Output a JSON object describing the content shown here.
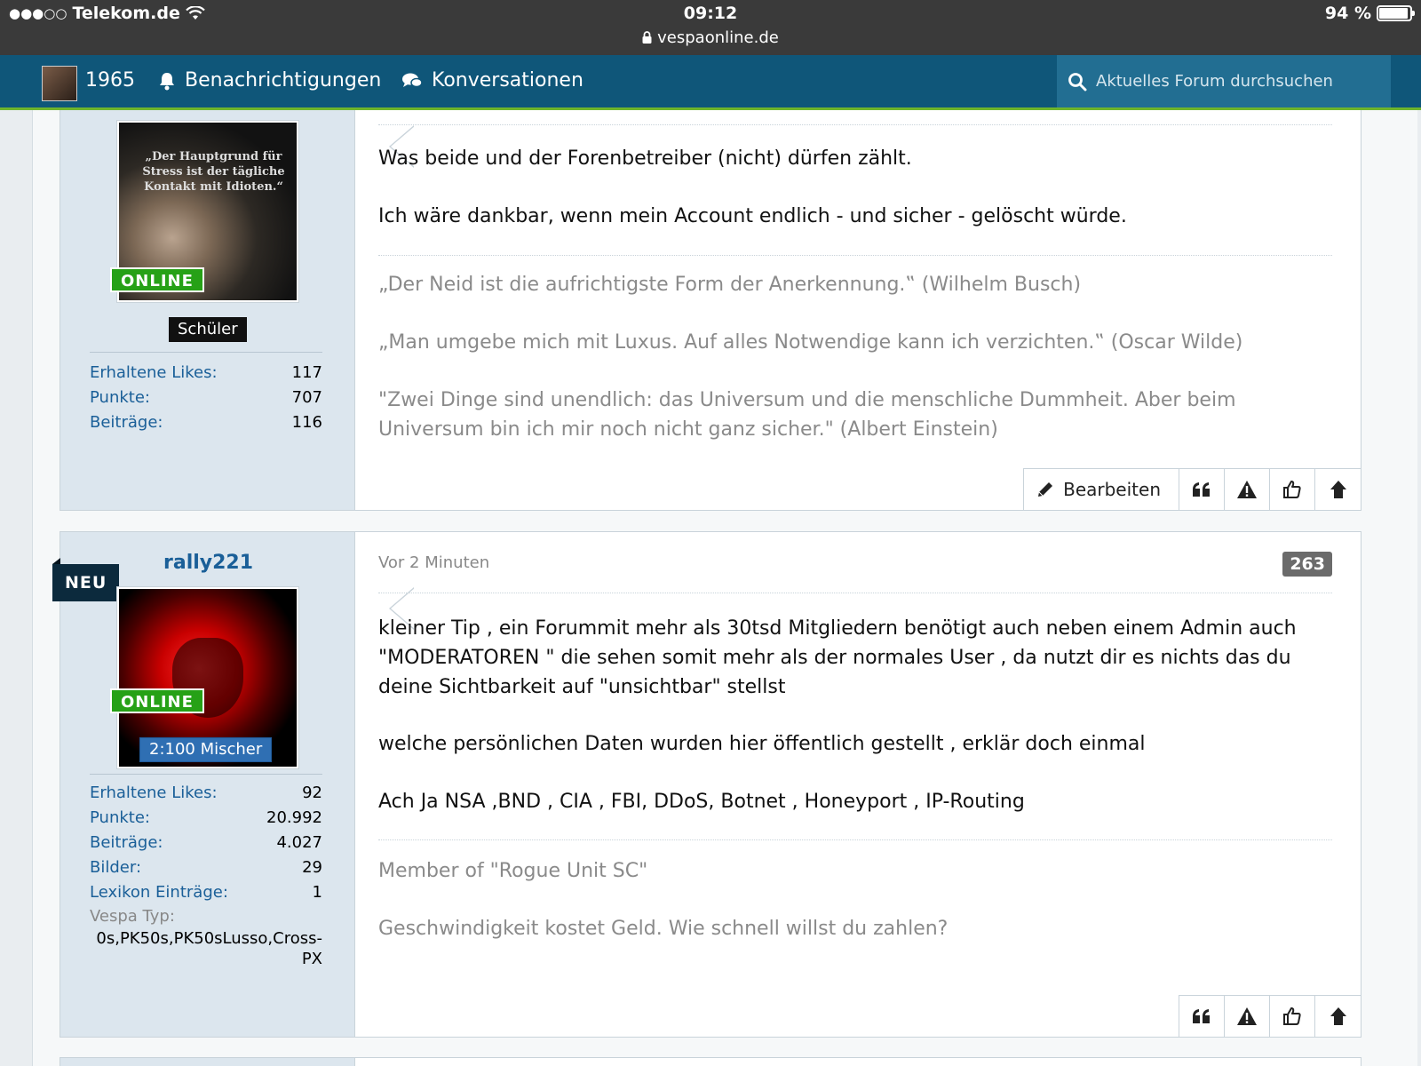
{
  "status_bar": {
    "signal": "●●●○○",
    "carrier": "Telekom.de",
    "time": "09:12",
    "url": "vespaonline.de",
    "battery": "94 %",
    "battery_level": 0.94
  },
  "nav": {
    "user_label": "1965",
    "notifications": "Benachrichtigungen",
    "conversations": "Konversationen",
    "search_placeholder": "Aktuelles Forum durchsuchen"
  },
  "icons": {
    "lock": "lock-icon",
    "wifi": "wifi-icon",
    "bell": "bell-icon",
    "chat": "chat-icon",
    "search": "search-icon",
    "edit": "pencil-icon",
    "quote": "quote-icon",
    "report": "warning-icon",
    "like": "thumbs-up-icon",
    "top": "arrow-up-icon"
  },
  "colors": {
    "nav": "#0f5679",
    "accent_green": "#6fb52c",
    "online": "#26a116",
    "link": "#1a5f98"
  },
  "post1": {
    "avatar_quote": "„Der Hauptgrund für Stress ist der tägliche Kontakt mit Idioten.“",
    "online": "ONLINE",
    "rank": "Schüler",
    "stats": [
      {
        "label": "Erhaltene Likes",
        "value": "117"
      },
      {
        "label": "Punkte",
        "value": "707"
      },
      {
        "label": "Beiträge",
        "value": "116"
      }
    ],
    "body": [
      "Was beide und der Forenbetreiber (nicht) dürfen zählt.",
      "Ich wäre dankbar, wenn mein Account endlich - und sicher - gelöscht würde."
    ],
    "signature": [
      "„Der Neid ist die aufrichtigste Form der Anerkennung.‟ (Wilhelm Busch)",
      "„Man umgebe mich mit Luxus. Auf alles Notwendige kann ich verzichten.‟ (Oscar Wilde)",
      "\"Zwei Dinge sind unendlich: das Universum und die menschliche Dummheit. Aber beim Universum bin ich mir noch nicht ganz sicher.\" (Albert Einstein)"
    ],
    "edit_label": "Bearbeiten"
  },
  "post2": {
    "badge": "NEU",
    "username": "rally221",
    "online": "ONLINE",
    "rank": "2:100 Mischer",
    "stats": [
      {
        "label": "Erhaltene Likes",
        "value": "92"
      },
      {
        "label": "Punkte",
        "value": "20.992"
      },
      {
        "label": "Beiträge",
        "value": "4.027"
      },
      {
        "label": "Bilder",
        "value": "29"
      },
      {
        "label": "Lexikon Einträge",
        "value": "1"
      }
    ],
    "vespa_label": "Vespa Typ:",
    "vespa_value_line1": "0s,PK50s,PK50sLusso,Cross-",
    "vespa_value_line2": "PX",
    "time": "Vor 2 Minuten",
    "post_number": "263",
    "body": [
      "kleiner Tip , ein Forummit mehr als 30tsd Mitgliedern benötigt auch neben einem Admin auch \"MODERATOREN \" die sehen somit mehr als der normales User , da nutzt dir es nichts das du deine Sichtbarkeit auf \"unsichtbar\" stellst",
      "welche persönlichen Daten wurden hier öffentlich gestellt , erklär doch einmal",
      "Ach Ja NSA ,BND , CIA , FBI, DDoS, Botnet , Honeyport , IP-Routing"
    ],
    "signature": [
      "Member of \"Rogue Unit SC\"",
      "Geschwindigkeit kostet Geld. Wie schnell willst du zahlen?"
    ]
  }
}
